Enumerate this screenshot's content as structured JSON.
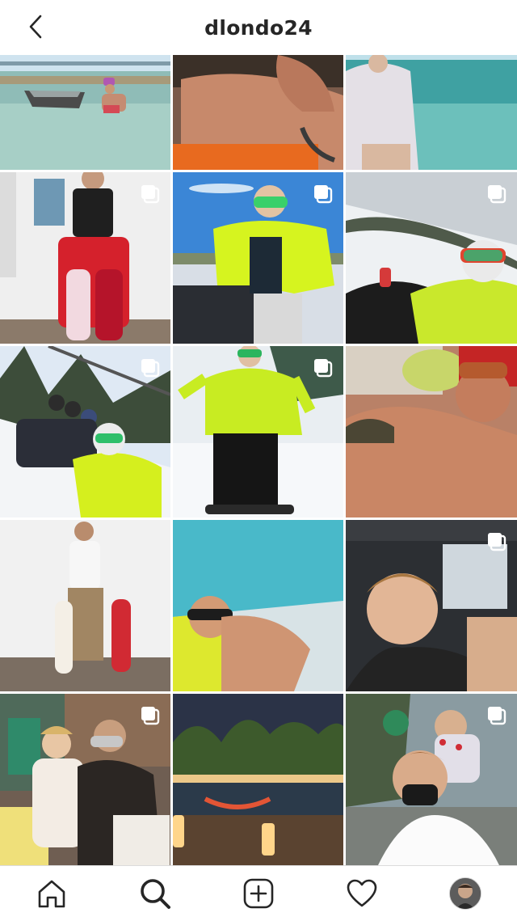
{
  "header": {
    "username": "dlondo24",
    "back_icon": "chevron-left-icon"
  },
  "grid": {
    "posts": [
      {
        "id": "p1",
        "multi": false,
        "scene": "boat-shallow-water"
      },
      {
        "id": "p2",
        "multi": false,
        "scene": "shirtless-selfie"
      },
      {
        "id": "p3",
        "multi": false,
        "scene": "boat-ocean-shirt"
      },
      {
        "id": "p4",
        "multi": true,
        "scene": "room-red-pants"
      },
      {
        "id": "p5",
        "multi": true,
        "scene": "snowmobile-yellow-jacket"
      },
      {
        "id": "p6",
        "multi": true,
        "scene": "snow-goggles-selfie"
      },
      {
        "id": "p7",
        "multi": true,
        "scene": "ski-lift-group"
      },
      {
        "id": "p8",
        "multi": true,
        "scene": "snowboard-yellow-jacket"
      },
      {
        "id": "p9",
        "multi": false,
        "scene": "shirtless-lying"
      },
      {
        "id": "p10",
        "multi": false,
        "scene": "white-wall-skateboards"
      },
      {
        "id": "p11",
        "multi": false,
        "scene": "pool-sunglasses"
      },
      {
        "id": "p12",
        "multi": true,
        "scene": "car-selfie"
      },
      {
        "id": "p13",
        "multi": true,
        "scene": "church-baby"
      },
      {
        "id": "p14",
        "multi": false,
        "scene": "night-dock-palms"
      },
      {
        "id": "p15",
        "multi": true,
        "scene": "child-on-shoulders"
      }
    ]
  },
  "nav": {
    "items": [
      {
        "name": "home",
        "icon": "home-icon"
      },
      {
        "name": "search",
        "icon": "search-icon"
      },
      {
        "name": "create",
        "icon": "add-post-icon"
      },
      {
        "name": "activity",
        "icon": "heart-icon"
      },
      {
        "name": "profile",
        "icon": "profile-avatar"
      }
    ]
  }
}
